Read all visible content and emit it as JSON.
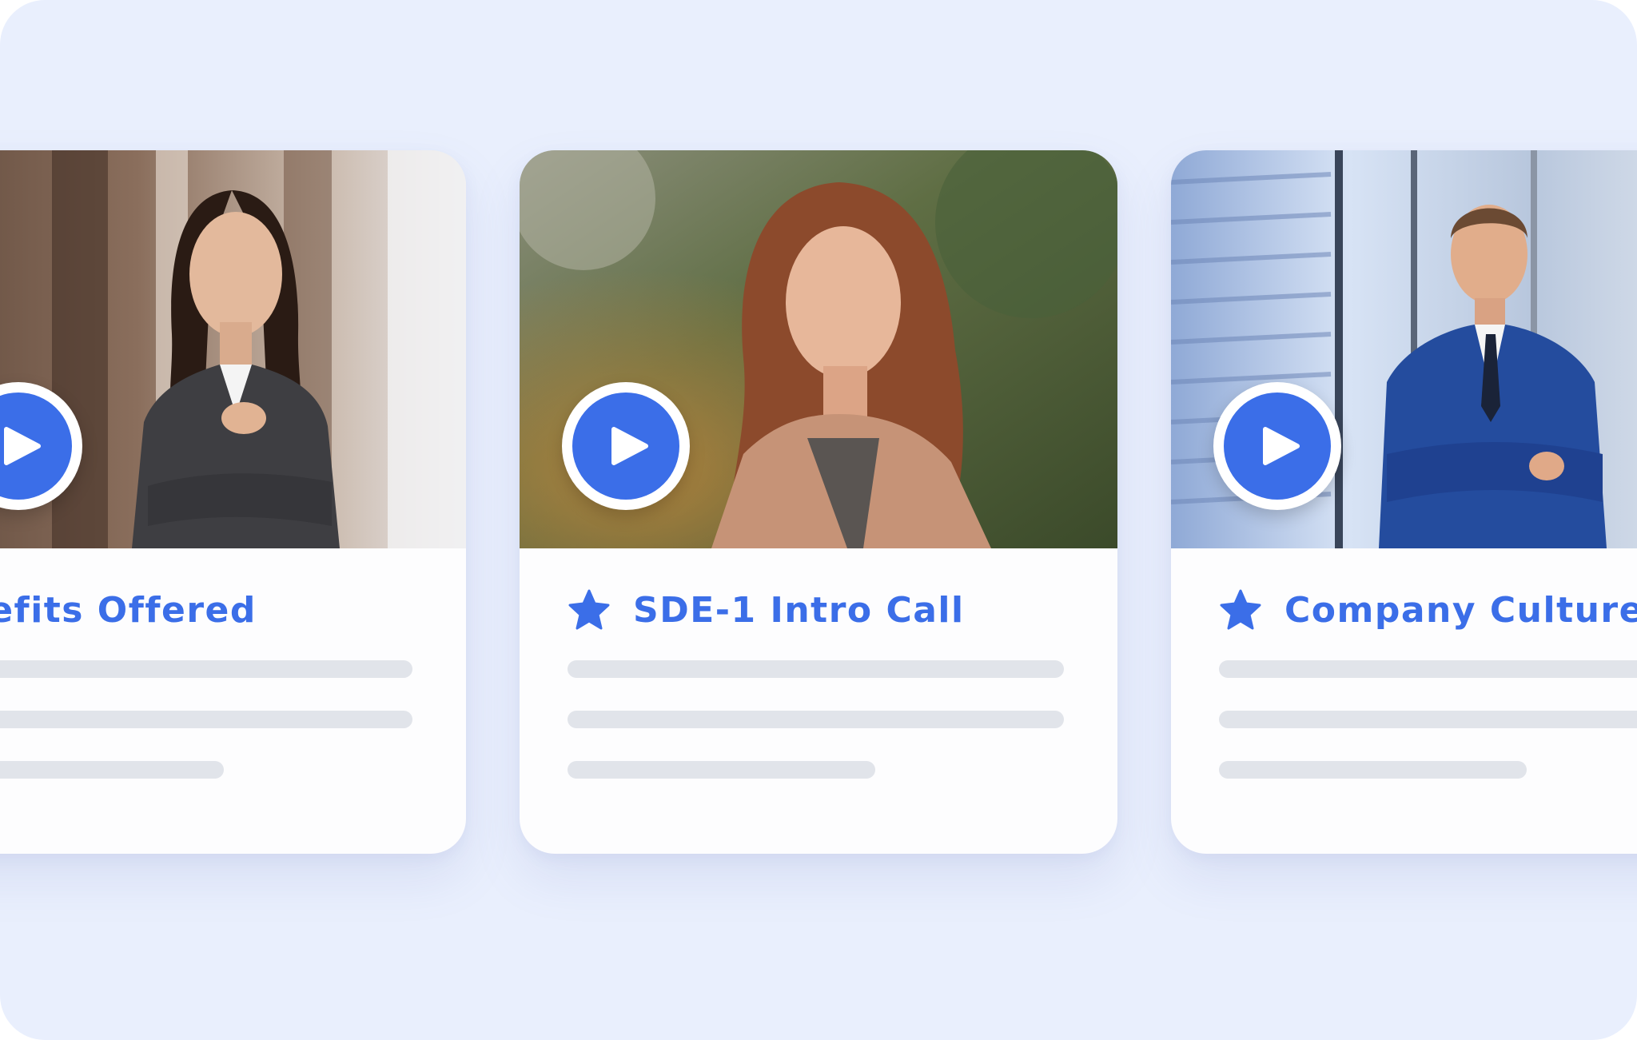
{
  "cards": [
    {
      "title": "Benefits Offered",
      "star_icon": "star-icon",
      "play_icon": "play-icon",
      "accent": "#3b6ee8"
    },
    {
      "title": "SDE-1 Intro Call",
      "star_icon": "star-icon",
      "play_icon": "play-icon",
      "accent": "#3b6ee8"
    },
    {
      "title": "Company Culture",
      "star_icon": "star-icon",
      "play_icon": "play-icon",
      "accent": "#3b6ee8"
    }
  ],
  "colors": {
    "background": "#e9effd",
    "card": "#fdfdfe",
    "accent": "#3b6ee8",
    "placeholder_line": "#e1e4ea"
  }
}
